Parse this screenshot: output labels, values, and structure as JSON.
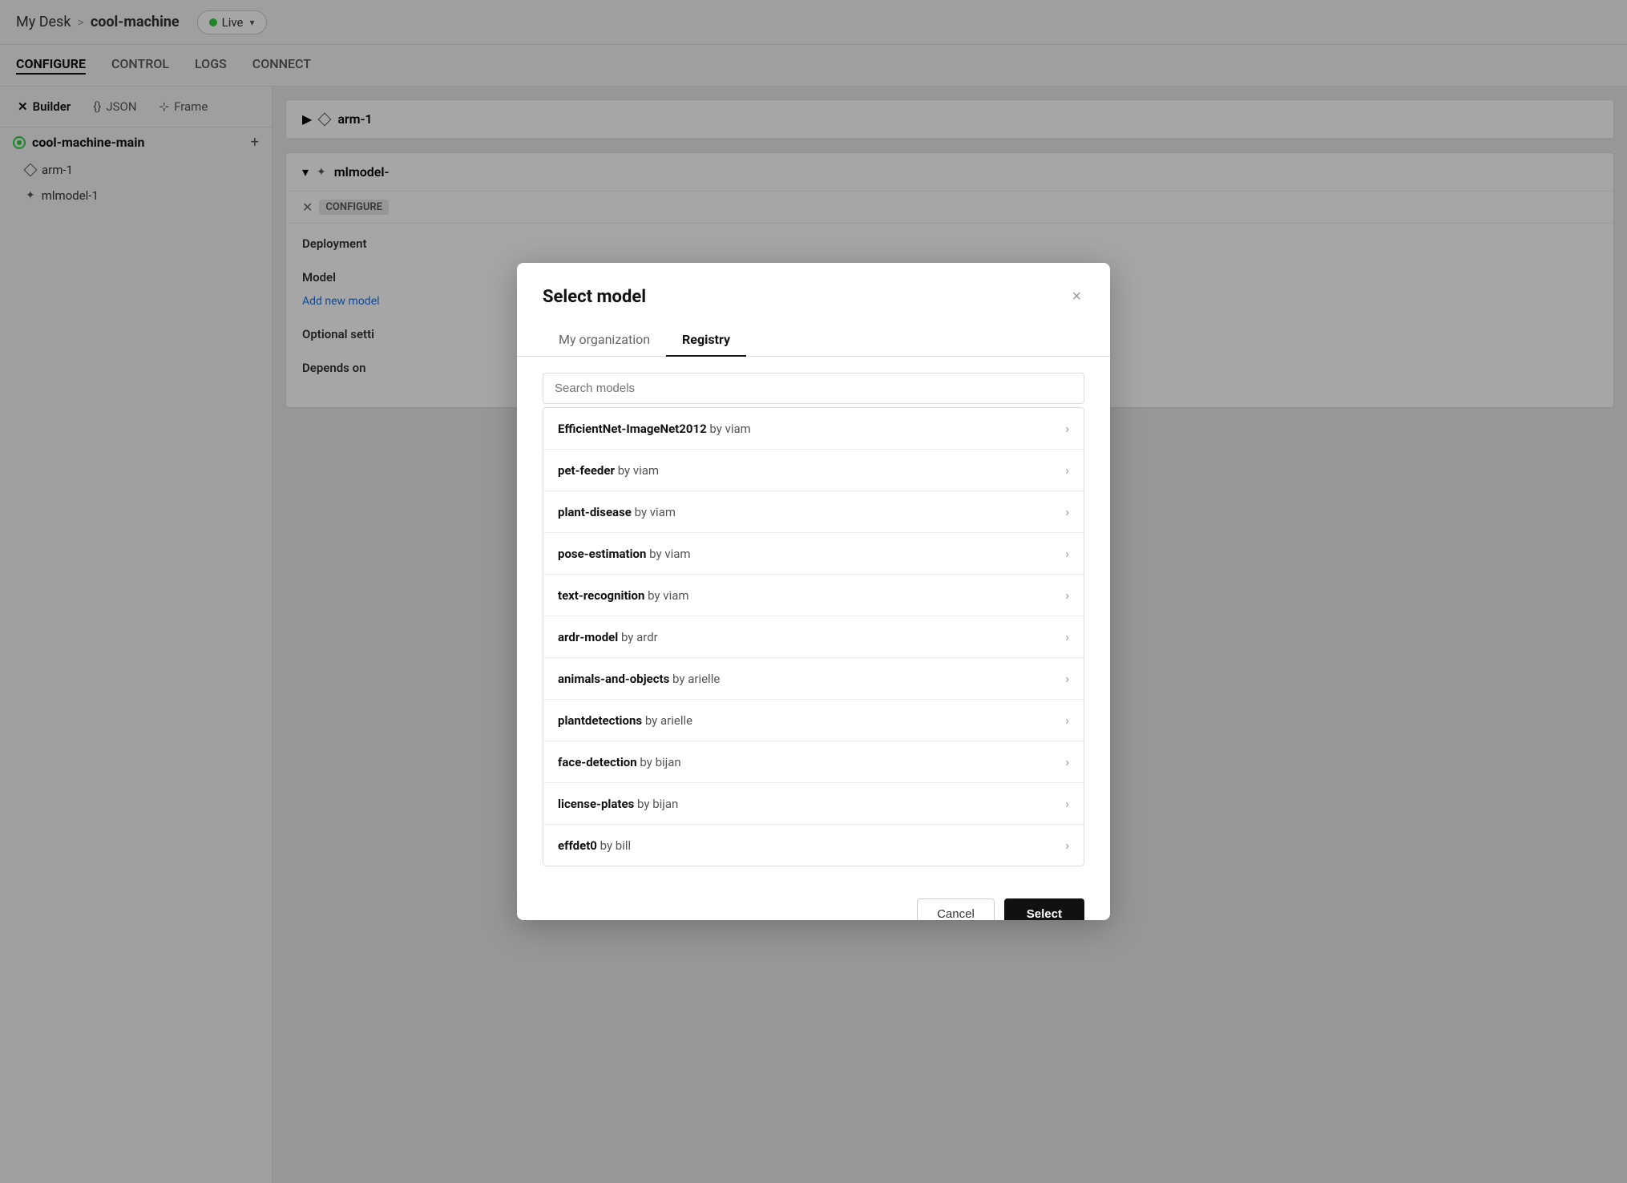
{
  "topbar": {
    "breadcrumb_home": "My Desk",
    "separator": ">",
    "machine": "cool-machine",
    "live_label": "Live"
  },
  "nav": {
    "tabs": [
      {
        "id": "configure",
        "label": "CONFIGURE",
        "active": true
      },
      {
        "id": "control",
        "label": "CONTROL",
        "active": false
      },
      {
        "id": "logs",
        "label": "LOGS",
        "active": false
      },
      {
        "id": "connect",
        "label": "CONNECT",
        "active": false
      }
    ]
  },
  "sidebar": {
    "view_tabs": [
      {
        "id": "builder",
        "label": "Builder",
        "icon": "wrench"
      },
      {
        "id": "json",
        "label": "JSON",
        "icon": "braces"
      },
      {
        "id": "frame",
        "label": "Frame",
        "icon": "frame"
      }
    ],
    "machine_name": "cool-machine-main",
    "items": [
      {
        "id": "arm-1",
        "label": "arm-1",
        "type": "diamond"
      },
      {
        "id": "mlmodel-1",
        "label": "mlmodel-1",
        "type": "star"
      }
    ]
  },
  "content": {
    "card1_title": "arm-1",
    "card2_title": "mlmodel-",
    "configure_label": "CONFIGURE",
    "deployment_label": "Deployment",
    "model_label": "Model",
    "add_model_link": "Add new model",
    "optional_settings_label": "Optional setti",
    "depends_on_label": "Depends on"
  },
  "modal": {
    "title": "Select model",
    "close_label": "×",
    "tabs": [
      {
        "id": "my-org",
        "label": "My organization",
        "active": false
      },
      {
        "id": "registry",
        "label": "Registry",
        "active": true
      }
    ],
    "search_placeholder": "Search models",
    "models": [
      {
        "name": "EfficientNet-ImageNet2012",
        "author": "by viam"
      },
      {
        "name": "pet-feeder",
        "author": "by viam"
      },
      {
        "name": "plant-disease",
        "author": "by viam"
      },
      {
        "name": "pose-estimation",
        "author": "by viam"
      },
      {
        "name": "text-recognition",
        "author": "by viam"
      },
      {
        "name": "ardr-model",
        "author": "by ardr"
      },
      {
        "name": "animals-and-objects",
        "author": "by arielle"
      },
      {
        "name": "plantdetections",
        "author": "by arielle"
      },
      {
        "name": "face-detection",
        "author": "by bijan"
      },
      {
        "name": "license-plates",
        "author": "by bijan"
      },
      {
        "name": "effdet0",
        "author": "by bill"
      }
    ],
    "cancel_label": "Cancel",
    "select_label": "Select"
  }
}
